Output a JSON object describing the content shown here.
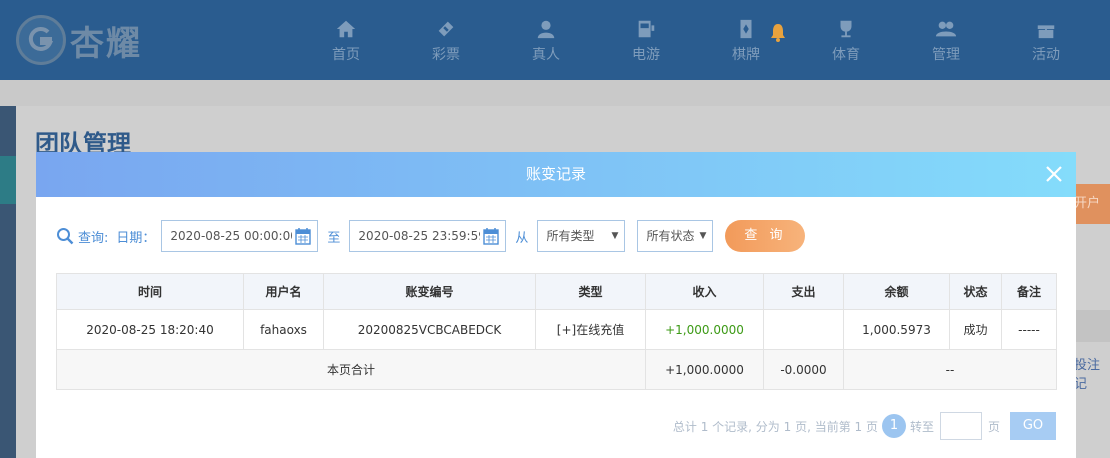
{
  "brand": {
    "name": "杏耀"
  },
  "nav": [
    {
      "label": "首页",
      "icon": "home-icon"
    },
    {
      "label": "彩票",
      "icon": "lottery-icon"
    },
    {
      "label": "真人",
      "icon": "live-casino-icon"
    },
    {
      "label": "电游",
      "icon": "slot-machine-icon"
    },
    {
      "label": "棋牌",
      "icon": "cards-icon"
    },
    {
      "label": "体育",
      "icon": "trophy-icon"
    },
    {
      "label": "管理",
      "icon": "users-icon"
    },
    {
      "label": "活动",
      "icon": "gift-icon"
    }
  ],
  "page": {
    "title": "团队管理",
    "side_button_peek": "开户",
    "side_link_peek": "投注记"
  },
  "modal": {
    "title": "账变记录",
    "filters": {
      "query_label": "查询:",
      "date_label": "日期：",
      "start": "2020-08-25 00:00:00",
      "to_label": "至",
      "end": "2020-08-25 23:59:59",
      "from_label": "从",
      "type_select": "所有类型",
      "status_select": "所有状态",
      "query_button": "查 询"
    },
    "table": {
      "headers": [
        "时间",
        "用户名",
        "账变编号",
        "类型",
        "收入",
        "支出",
        "余额",
        "状态",
        "备注"
      ],
      "row": {
        "time": "2020-08-25 18:20:40",
        "username": "fahaoxs",
        "code": "20200825VCBCABEDCK",
        "type": "[+]在线充值",
        "income": "+1,000.0000",
        "expense": "",
        "balance": "1,000.5973",
        "status": "成功",
        "remark": "-----"
      },
      "summary": {
        "label": "本页合计",
        "income": "+1,000.0000",
        "expense": "-0.0000",
        "balance": "--"
      }
    },
    "pager": {
      "info": "总计 1 个记录, 分为 1 页, 当前第 1 页",
      "current": "1",
      "goto_label": "转至",
      "page_unit": "页",
      "go_button": "GO"
    }
  },
  "colors": {
    "nav_bg": "#2a5c8f",
    "modal_header_from": "#79a6f0",
    "modal_header_to": "#84dcfb",
    "accent_orange": "#f29a5a",
    "income_green": "#3d9a16"
  }
}
